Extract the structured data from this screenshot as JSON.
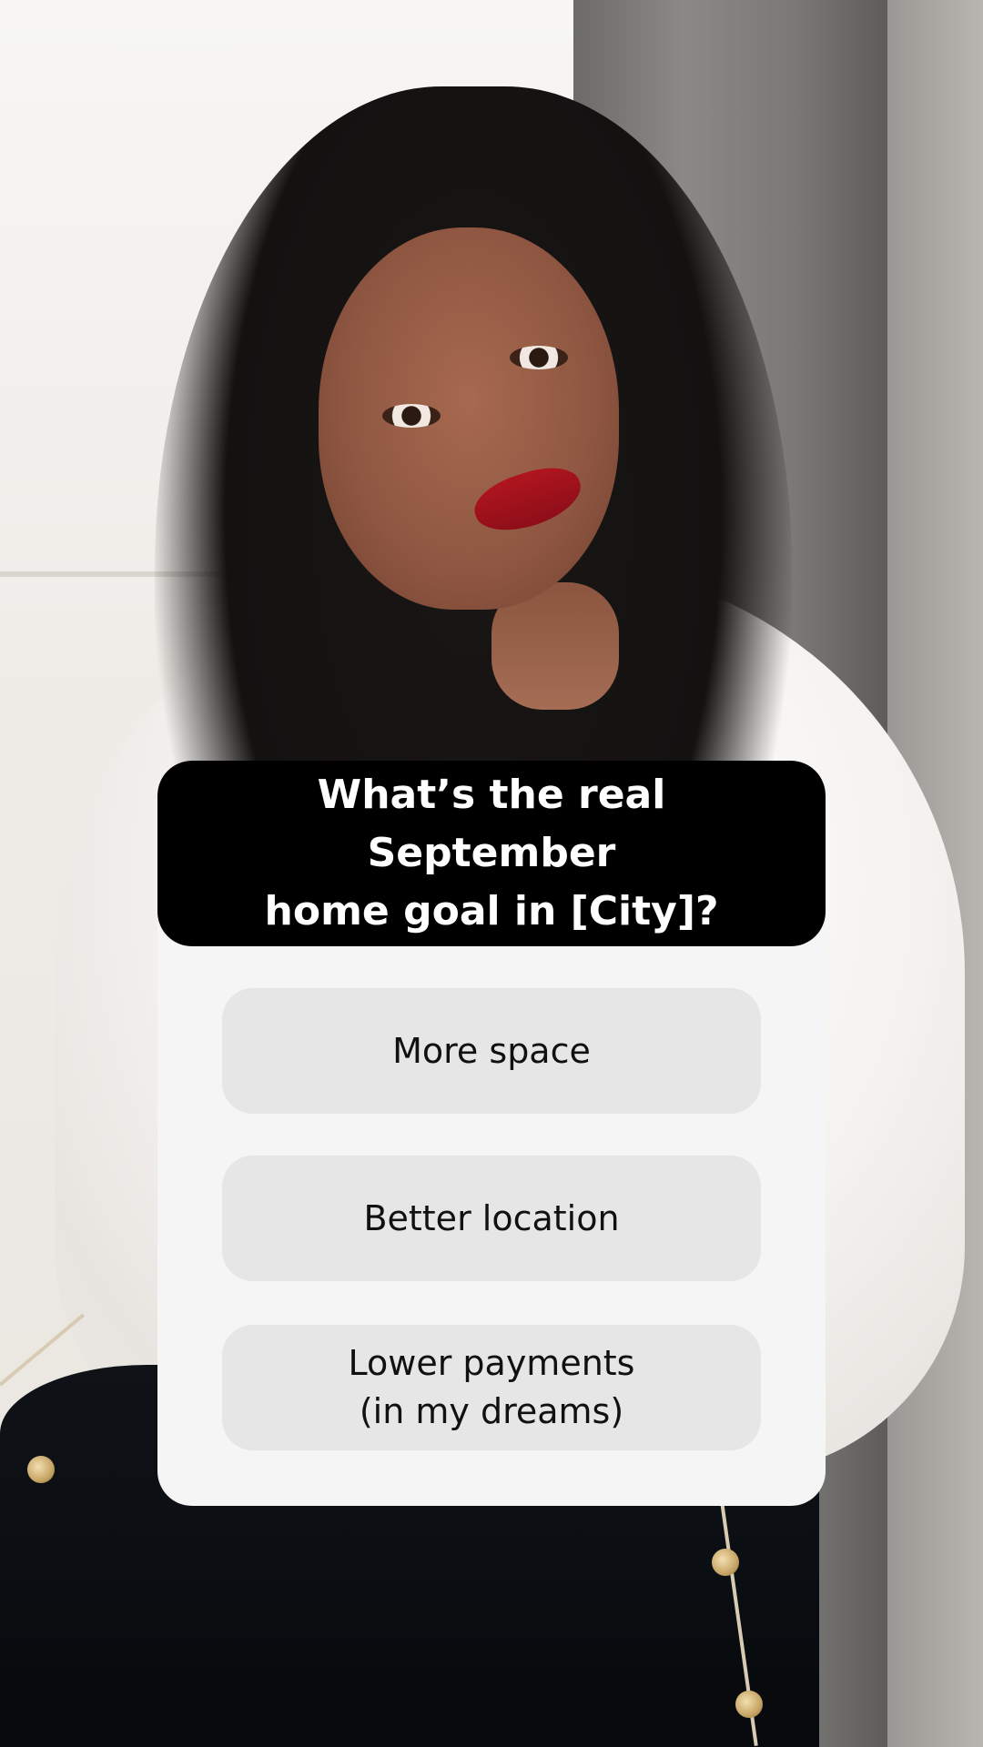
{
  "poll": {
    "question_line1": "What’s the real September",
    "question_line2": "home goal in [City]?",
    "options": [
      {
        "lines": [
          "More space"
        ]
      },
      {
        "lines": [
          "Better location"
        ]
      },
      {
        "lines": [
          "Lower payments",
          "(in my dreams)"
        ]
      }
    ]
  },
  "colors": {
    "header_bg": "#000000",
    "card_bg": "#f5f5f6",
    "option_bg": "#e6e6e6",
    "question_text": "#ffffff",
    "option_text": "#111111"
  }
}
